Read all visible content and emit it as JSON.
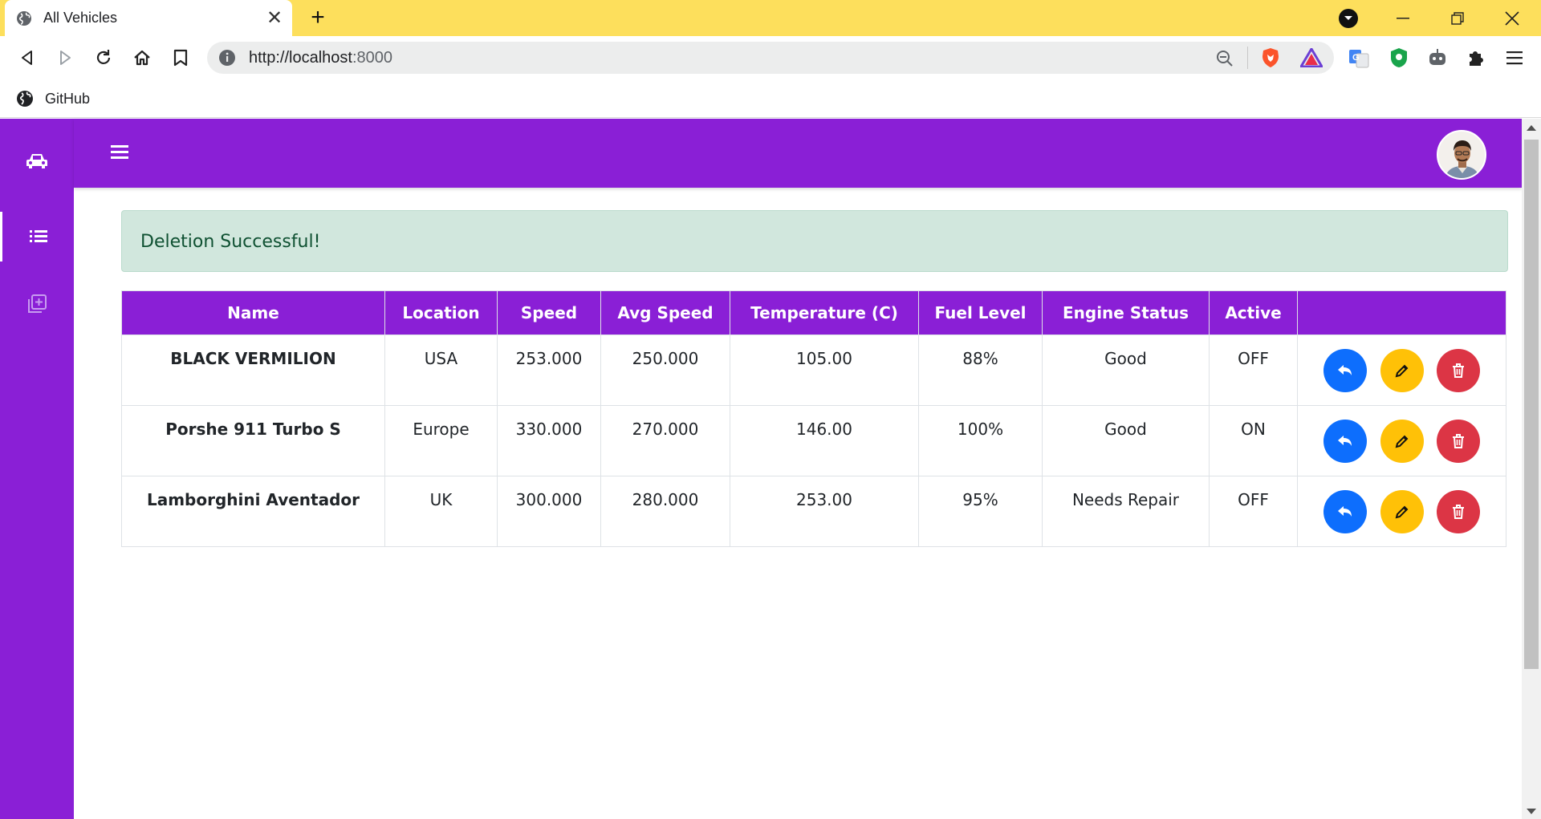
{
  "browser": {
    "tab_title": "All Vehicles",
    "url_host": "http://localhost",
    "url_port": ":8000",
    "bookmark_label": "GitHub"
  },
  "alert": {
    "message": "Deletion Successful!"
  },
  "table": {
    "headers": [
      "Name",
      "Location",
      "Speed",
      "Avg Speed",
      "Temperature (C)",
      "Fuel Level",
      "Engine Status",
      "Active",
      ""
    ],
    "rows": [
      {
        "name": "BLACK VERMILION",
        "location": "USA",
        "speed": "253.000",
        "avg_speed": "250.000",
        "temperature": "105.00",
        "fuel": "88%",
        "engine": "Good",
        "active": "OFF"
      },
      {
        "name": "Porshe 911 Turbo S",
        "location": "Europe",
        "speed": "330.000",
        "avg_speed": "270.000",
        "temperature": "146.00",
        "fuel": "100%",
        "engine": "Good",
        "active": "ON"
      },
      {
        "name": "Lamborghini Aventador",
        "location": "UK",
        "speed": "300.000",
        "avg_speed": "280.000",
        "temperature": "253.00",
        "fuel": "95%",
        "engine": "Needs Repair",
        "active": "OFF"
      }
    ]
  },
  "colors": {
    "brand": "#8a1fd6",
    "reply": "#0d6efd",
    "edit": "#ffc107",
    "delete": "#dc3545",
    "alert_bg": "#d1e7dd"
  }
}
